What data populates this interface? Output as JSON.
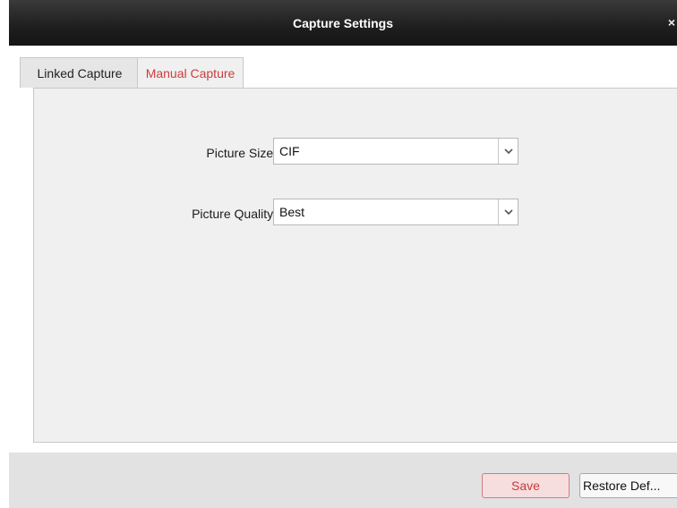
{
  "dialog": {
    "title": "Capture Settings",
    "close_glyph": "×"
  },
  "tabs": [
    {
      "label": "Linked Capture",
      "active": false
    },
    {
      "label": "Manual Capture",
      "active": true
    }
  ],
  "form": {
    "picture_size": {
      "label": "Picture Size:",
      "value": "CIF"
    },
    "picture_quality": {
      "label": "Picture Quality:",
      "value": "Best"
    }
  },
  "footer": {
    "save_label": "Save",
    "restore_label": "Restore Def..."
  },
  "colors": {
    "accent_red": "#d13b3b",
    "titlebar": "#1e1e1e"
  },
  "icons": {
    "close": "close-icon",
    "dropdown": "chevron-down-icon"
  }
}
